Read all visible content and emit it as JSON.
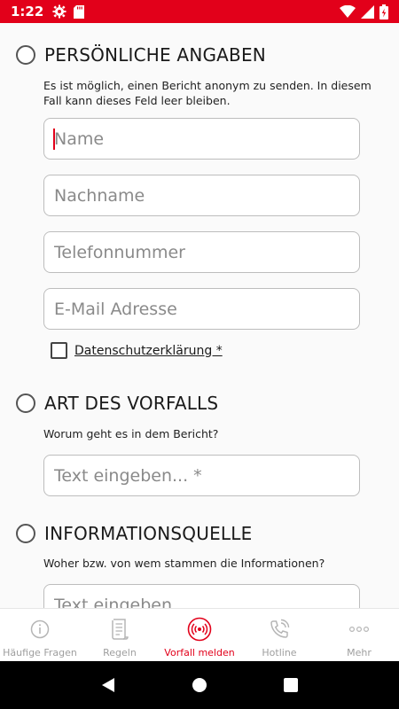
{
  "status_bar": {
    "time": "1:22",
    "left_icons": [
      "gear-icon",
      "sd-card-icon"
    ],
    "right_icons": [
      "wifi-icon",
      "signal-icon",
      "battery-charging-icon"
    ]
  },
  "sections": {
    "personal": {
      "title": "PERSÖNLICHE ANGABEN",
      "description": "Es ist möglich, einen Bericht anonym zu senden. In diesem Fall kann dieses Feld leer bleiben.",
      "fields": {
        "first_name": {
          "value": "",
          "placeholder": "Name"
        },
        "last_name": {
          "value": "",
          "placeholder": "Nachname"
        },
        "phone": {
          "value": "",
          "placeholder": "Telefonnummer"
        },
        "email": {
          "value": "",
          "placeholder": "E-Mail Adresse"
        }
      },
      "privacy_label": "Datenschutzerklärung *"
    },
    "incident_type": {
      "title": "ART DES VORFALLS",
      "description": "Worum geht es in dem Bericht?",
      "field": {
        "value": "",
        "placeholder": "Text eingeben... *"
      }
    },
    "source": {
      "title": "INFORMATIONSQUELLE",
      "description": "Woher bzw. von wem stammen die Informationen?",
      "field": {
        "value": "",
        "placeholder": "Text eingeben..."
      }
    }
  },
  "tabs": [
    {
      "label": "Häufige Fragen",
      "icon": "info-icon",
      "active": false
    },
    {
      "label": "Regeln",
      "icon": "rules-scroll-icon",
      "active": false
    },
    {
      "label": "Vorfall melden",
      "icon": "report-broadcast-icon",
      "active": true
    },
    {
      "label": "Hotline",
      "icon": "phone-icon",
      "active": false
    },
    {
      "label": "Mehr",
      "icon": "more-dots-icon",
      "active": false
    }
  ],
  "colors": {
    "brand_red": "#e2001a",
    "inactive_gray": "#9e9e9e",
    "background": "#fafafa"
  },
  "nav_bar": {
    "buttons": [
      "back-icon",
      "home-icon",
      "recents-icon"
    ]
  }
}
